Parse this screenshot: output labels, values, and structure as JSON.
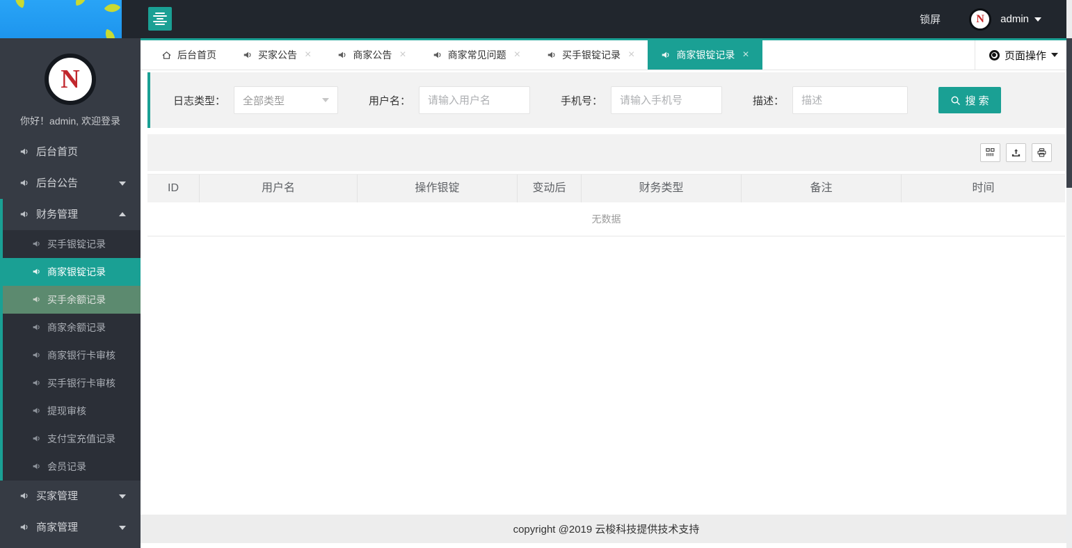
{
  "colors": {
    "accent": "#1aa094",
    "topbar": "#21262d",
    "sidebar": "#363b44"
  },
  "topbar": {
    "lock_label": "锁屏",
    "username": "admin",
    "logo_letter": "N"
  },
  "sidebar": {
    "greeting": "你好！admin, 欢迎登录",
    "items_top": [
      {
        "label": "后台首页"
      },
      {
        "label": "后台公告"
      }
    ],
    "finance": {
      "label": "财务管理",
      "children": [
        "买手银锭记录",
        "商家银锭记录",
        "买手余额记录",
        "商家余额记录",
        "商家银行卡审核",
        "买手银行卡审核",
        "提现审核",
        "支付宝充值记录",
        "会员记录"
      ]
    },
    "items_bottom": [
      {
        "label": "买家管理"
      },
      {
        "label": "商家管理"
      }
    ]
  },
  "tabs": {
    "home": "后台首页",
    "items": [
      "买家公告",
      "商家公告",
      "商家常见问题",
      "买手银锭记录",
      "商家银锭记录"
    ],
    "active": "商家银锭记录",
    "page_ops": "页面操作"
  },
  "filters": {
    "log_type_label": "日志类型：",
    "log_type_value": "全部类型",
    "username_label": "用户名：",
    "username_placeholder": "请输入用户名",
    "phone_label": "手机号：",
    "phone_placeholder": "请输入手机号",
    "desc_label": "描述：",
    "desc_placeholder": "描述",
    "search_label": "搜 索"
  },
  "table": {
    "columns": [
      "ID",
      "用户名",
      "操作银锭",
      "变动后",
      "财务类型",
      "备注",
      "时间"
    ],
    "empty_text": "无数据",
    "rows": []
  },
  "footer": {
    "copyright": "copyright @2019 云梭科技提供技术支持"
  }
}
